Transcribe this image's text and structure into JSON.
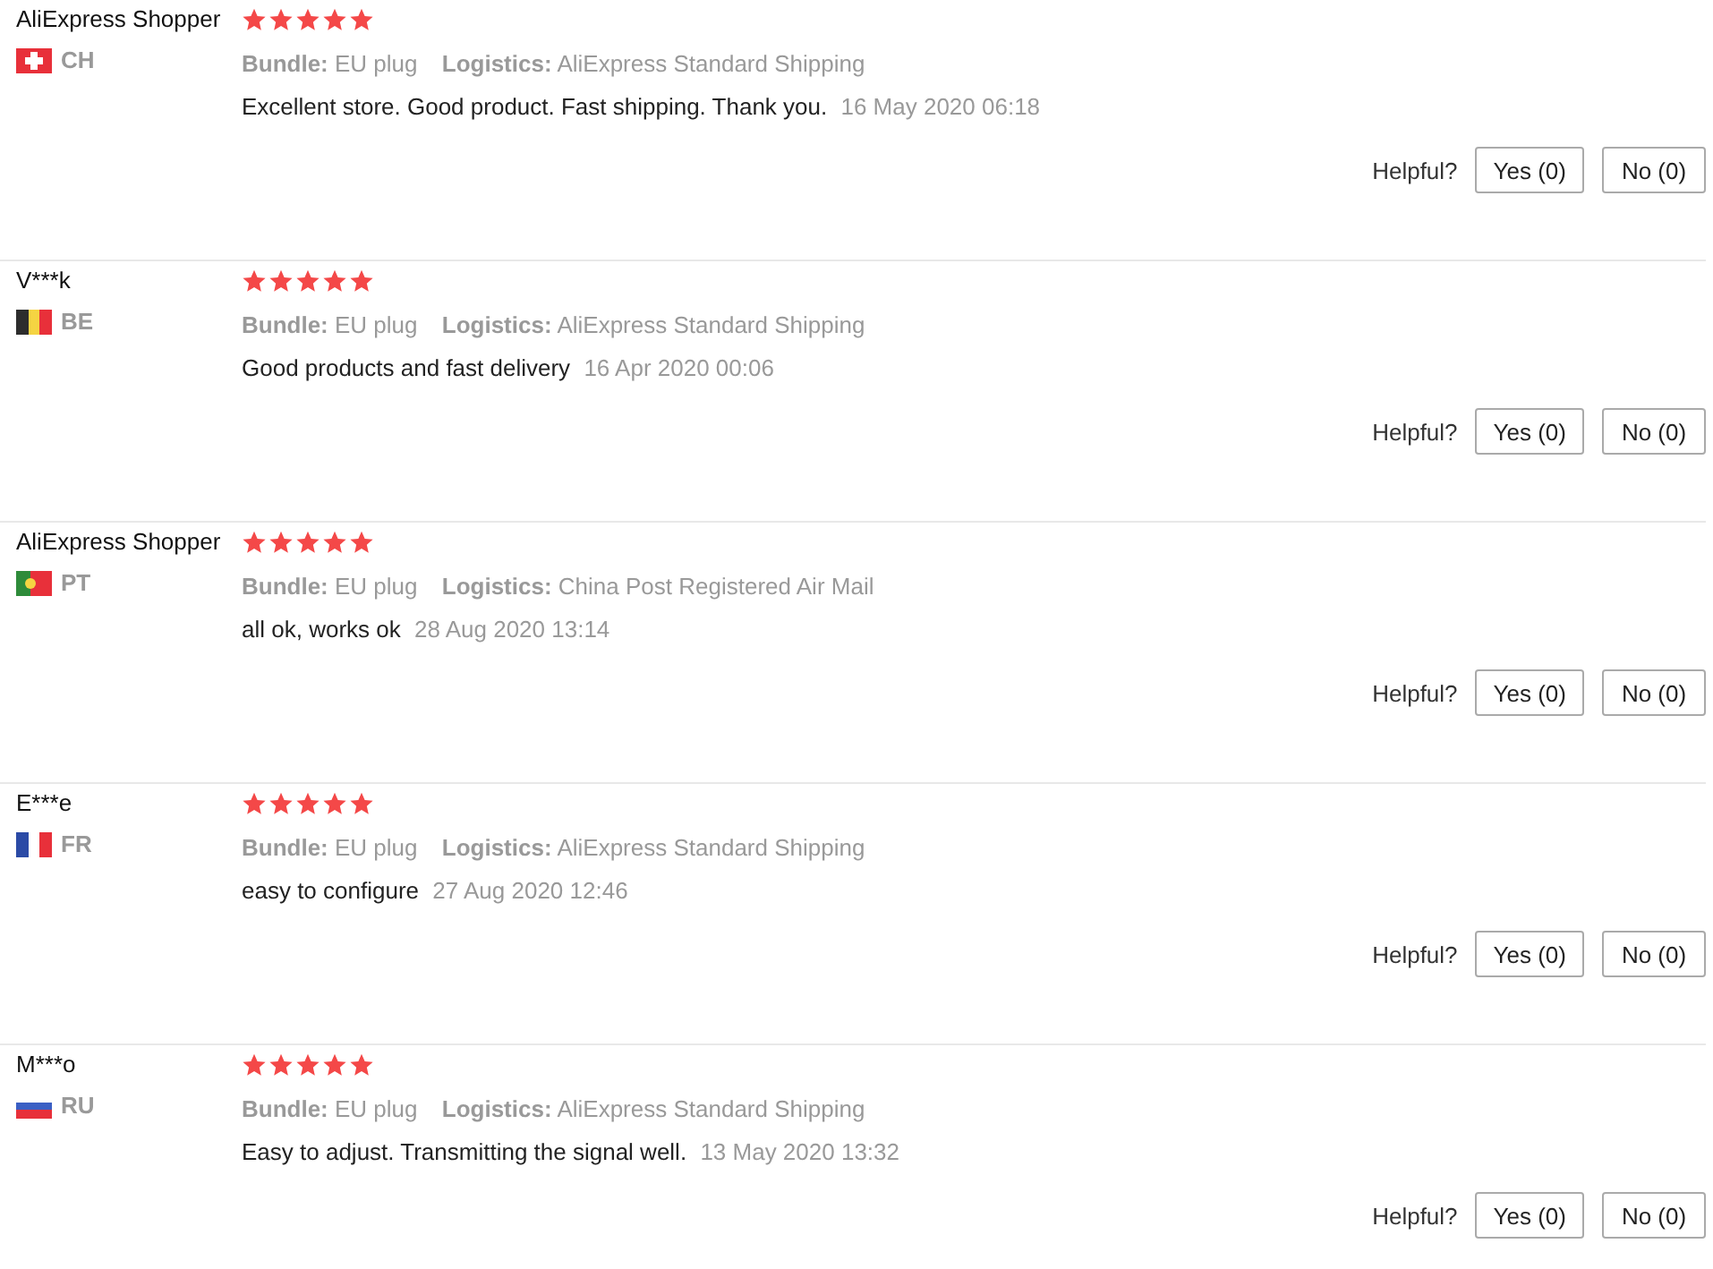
{
  "reviews": [
    {
      "name": "AliExpress Shopper",
      "stars": 5,
      "flag": {
        "kind": "ch"
      },
      "country": "CH",
      "bundle_label": "Bundle:",
      "bundle": "EU plug",
      "logistics_label": "Logistics:",
      "logistics": "AliExpress Standard Shipping",
      "text": "Excellent store. Good product. Fast shipping. Thank you.",
      "date": "16 May 2020 06:18",
      "helpful": "Helpful?",
      "yes": "Yes (0)",
      "no": "No (0)"
    },
    {
      "name": "V***k",
      "stars": 5,
      "flag": {
        "kind": "be"
      },
      "country": "BE",
      "bundle_label": "Bundle:",
      "bundle": "EU plug",
      "logistics_label": "Logistics:",
      "logistics": "AliExpress Standard Shipping",
      "text": "Good products and fast delivery",
      "date": "16 Apr 2020 00:06",
      "helpful": "Helpful?",
      "yes": "Yes (0)",
      "no": "No (0)"
    },
    {
      "name": "AliExpress Shopper",
      "stars": 5,
      "flag": {
        "kind": "pt"
      },
      "country": "PT",
      "bundle_label": "Bundle:",
      "bundle": "EU plug",
      "logistics_label": "Logistics:",
      "logistics": "China Post Registered Air Mail",
      "text": "all ok, works ok",
      "date": "28 Aug 2020 13:14",
      "helpful": "Helpful?",
      "yes": "Yes (0)",
      "no": "No (0)"
    },
    {
      "name": "E***e",
      "stars": 5,
      "flag": {
        "kind": "fr"
      },
      "country": "FR",
      "bundle_label": "Bundle:",
      "bundle": "EU plug",
      "logistics_label": "Logistics:",
      "logistics": "AliExpress Standard Shipping",
      "text": "easy to configure",
      "date": "27 Aug 2020 12:46",
      "helpful": "Helpful?",
      "yes": "Yes (0)",
      "no": "No (0)"
    },
    {
      "name": "M***o",
      "stars": 5,
      "flag": {
        "kind": "ru"
      },
      "country": "RU",
      "bundle_label": "Bundle:",
      "bundle": "EU plug",
      "logistics_label": "Logistics:",
      "logistics": "AliExpress Standard Shipping",
      "text": "Easy to adjust. Transmitting the signal well.",
      "date": "13 May 2020 13:32",
      "helpful": "Helpful?",
      "yes": "Yes (0)",
      "no": "No (0)"
    }
  ]
}
